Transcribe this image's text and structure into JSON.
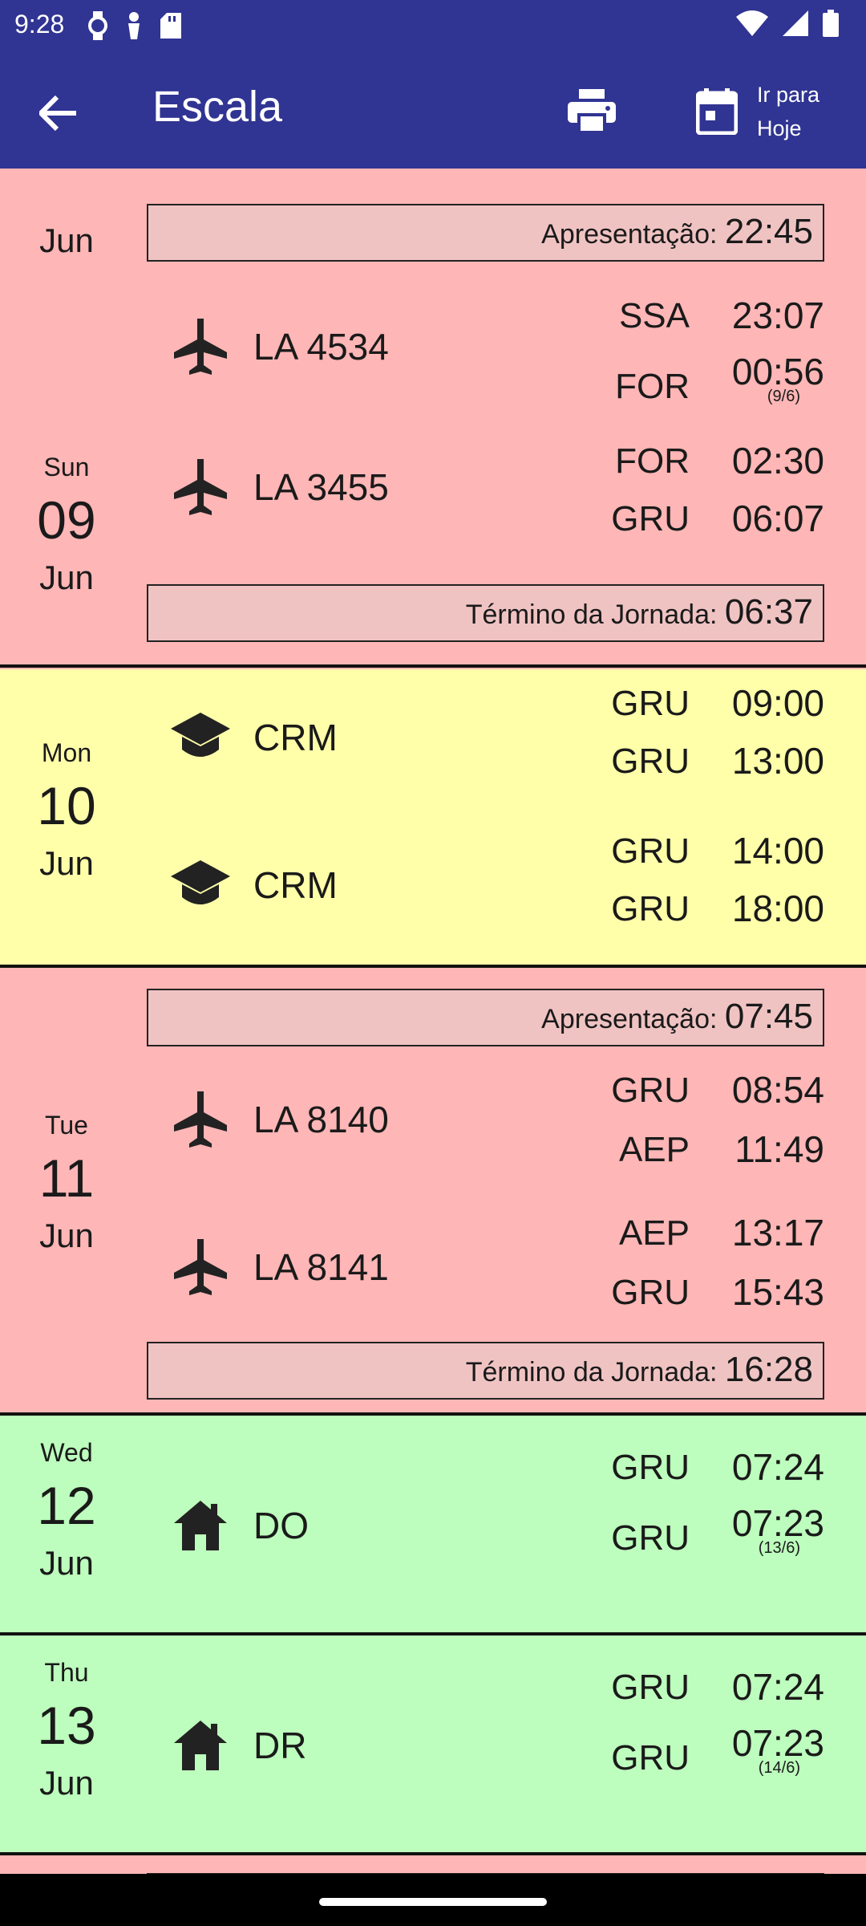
{
  "status": {
    "time": "9:28"
  },
  "appbar": {
    "title": "Escala",
    "today_label_1": "Ir para",
    "today_label_2": "Hoje",
    "back_icon": "arrow-back-icon",
    "print_icon": "print-icon",
    "calendar_icon": "calendar-icon"
  },
  "days": {
    "d08": {
      "month": "Jun",
      "box": {
        "label": "Apresentação:",
        "time": "22:45"
      },
      "acts": [
        {
          "name": "LA 4534",
          "icon": "airplane-icon",
          "dep_apt": "SSA",
          "dep_time": "23:07",
          "arr_apt": "FOR",
          "arr_time": "00:56",
          "note": "(9/6)"
        }
      ]
    },
    "d09": {
      "dow": "Sun",
      "day": "09",
      "month": "Jun",
      "acts": [
        {
          "name": "LA 3455",
          "icon": "airplane-icon",
          "dep_apt": "FOR",
          "dep_time": "02:30",
          "arr_apt": "GRU",
          "arr_time": "06:07"
        }
      ],
      "box": {
        "label": "Término da Jornada:",
        "time": "06:37"
      }
    },
    "d10": {
      "dow": "Mon",
      "day": "10",
      "month": "Jun",
      "acts": [
        {
          "name": "CRM",
          "icon": "graduation-cap-icon",
          "dep_apt": "GRU",
          "dep_time": "09:00",
          "arr_apt": "GRU",
          "arr_time": "13:00"
        },
        {
          "name": "CRM",
          "icon": "graduation-cap-icon",
          "dep_apt": "GRU",
          "dep_time": "14:00",
          "arr_apt": "GRU",
          "arr_time": "18:00"
        }
      ]
    },
    "d11": {
      "dow": "Tue",
      "day": "11",
      "month": "Jun",
      "box_top": {
        "label": "Apresentação:",
        "time": "07:45"
      },
      "acts": [
        {
          "name": "LA 8140",
          "icon": "airplane-icon",
          "dep_apt": "GRU",
          "dep_time": "08:54",
          "arr_apt": "AEP",
          "arr_time": "11:49"
        },
        {
          "name": "LA 8141",
          "icon": "airplane-icon",
          "dep_apt": "AEP",
          "dep_time": "13:17",
          "arr_apt": "GRU",
          "arr_time": "15:43"
        }
      ],
      "box_bottom": {
        "label": "Término da Jornada:",
        "time": "16:28"
      }
    },
    "d12": {
      "dow": "Wed",
      "day": "12",
      "month": "Jun",
      "acts": [
        {
          "name": "DO",
          "icon": "home-icon",
          "dep_apt": "GRU",
          "dep_time": "07:24",
          "arr_apt": "GRU",
          "arr_time": "07:23",
          "note": "(13/6)"
        }
      ]
    },
    "d13": {
      "dow": "Thu",
      "day": "13",
      "month": "Jun",
      "acts": [
        {
          "name": "DR",
          "icon": "home-icon",
          "dep_apt": "GRU",
          "dep_time": "07:24",
          "arr_apt": "GRU",
          "arr_time": "07:23",
          "note": "(14/6)"
        }
      ]
    }
  },
  "colors": {
    "appbar": "#303492",
    "flight_day": "#ffb6b6",
    "training_day": "#ffffaa",
    "off_day": "#bdfdbd",
    "box": "#f0c3c3"
  }
}
